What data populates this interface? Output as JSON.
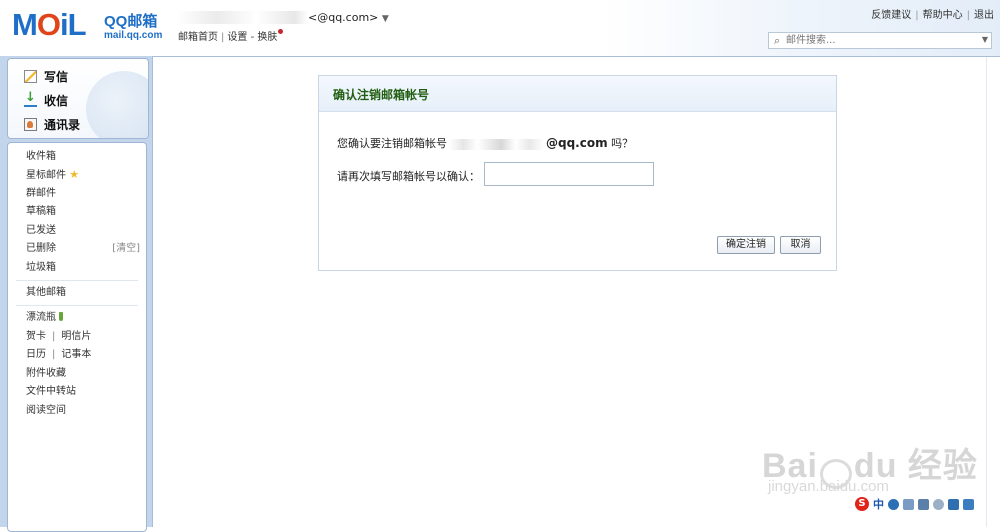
{
  "header": {
    "logo_text": "MOiL",
    "brand": "QQ邮箱",
    "domain": "mail.qq.com",
    "account": "<@qq.com>",
    "nav": {
      "home": "邮箱首页",
      "settings": "设置",
      "dash": "-",
      "skin": "换肤"
    },
    "toplinks": {
      "feedback": "反馈建议",
      "help": "帮助中心",
      "logout": "退出"
    },
    "search_placeholder": "邮件搜索..."
  },
  "sidebar": {
    "quick": {
      "compose": "写信",
      "receive": "收信",
      "contacts": "通讯录"
    },
    "folders": {
      "inbox": "收件箱",
      "starred": "星标邮件",
      "group": "群邮件",
      "drafts": "草稿箱",
      "sent": "已发送",
      "deleted": "已删除",
      "clear": "[清空]",
      "trash": "垃圾箱",
      "other": "其他邮箱",
      "bottle": "漂流瓶",
      "greeting_card": "贺卡",
      "postcard": "明信片",
      "calendar": "日历",
      "notebook": "记事本",
      "attachments": "附件收藏",
      "file_transfer": "文件中转站",
      "reading": "阅读空间"
    }
  },
  "dialog": {
    "title": "确认注销邮箱帐号",
    "question_prefix": "您确认要注销邮箱帐号",
    "question_domain": "@qq.com",
    "question_suffix": "吗？",
    "confirm_label": "请再次填写邮箱帐号以确认：",
    "input_value": "",
    "ok": "确定注销",
    "cancel": "取消"
  },
  "watermark": {
    "main": "Bai",
    "main2": "du 经验",
    "sub": "jingyan.baidu.com"
  },
  "ime": {
    "logo": "S",
    "mode": "中"
  },
  "colors": {
    "brand_blue": "#1f6fc7",
    "frame_blue": "#c3d5ea",
    "dialog_title_green": "#215e11"
  }
}
